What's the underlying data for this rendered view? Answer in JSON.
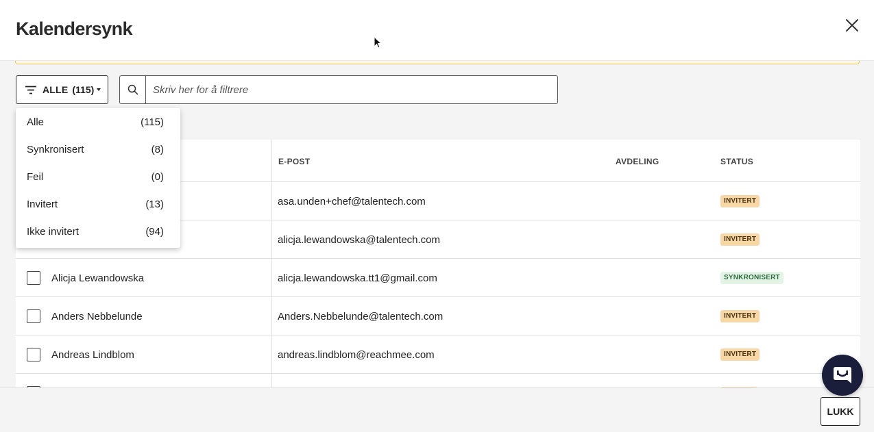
{
  "dialog": {
    "title": "Kalendersynk",
    "close_icon": "close-icon"
  },
  "filter": {
    "icon": "filter-lines-icon",
    "label": "ALLE",
    "count": "(115)",
    "options": [
      {
        "label": "Alle",
        "count": "(115)"
      },
      {
        "label": "Synkronisert",
        "count": "(8)"
      },
      {
        "label": "Feil",
        "count": "(0)"
      },
      {
        "label": "Invitert",
        "count": "(13)"
      },
      {
        "label": "Ikke invitert",
        "count": "(94)"
      }
    ]
  },
  "search": {
    "placeholder": "Skriv her for å filtrere",
    "value": "",
    "icon": "search-icon"
  },
  "table": {
    "columns": {
      "email": "E-POST",
      "department": "AVDELING",
      "status": "STATUS"
    },
    "rows": [
      {
        "name": "",
        "email": "asa.unden+chef@talentech.com",
        "department": "",
        "status": "INVITERT"
      },
      {
        "name": "",
        "email": "alicja.lewandowska@talentech.com",
        "department": "",
        "status": "INVITERT"
      },
      {
        "name": "Alicja Lewandowska",
        "email": "alicja.lewandowska.tt1@gmail.com",
        "department": "",
        "status": "SYNKRONISERT"
      },
      {
        "name": "Anders Nebbelunde",
        "email": "Anders.Nebbelunde@talentech.com",
        "department": "",
        "status": "INVITERT"
      },
      {
        "name": "Andreas Lindblom",
        "email": "andreas.lindblom@reachmee.com",
        "department": "",
        "status": "INVITERT"
      }
    ]
  },
  "footer": {
    "close_label": "LUKK"
  },
  "chat": {
    "icon": "chat-support-icon"
  },
  "colors": {
    "invited_badge": "#f8d7a6",
    "synced_badge": "#e3f4e6",
    "chat_bg": "#1b1e3a",
    "warning_border": "#f0c45a"
  }
}
